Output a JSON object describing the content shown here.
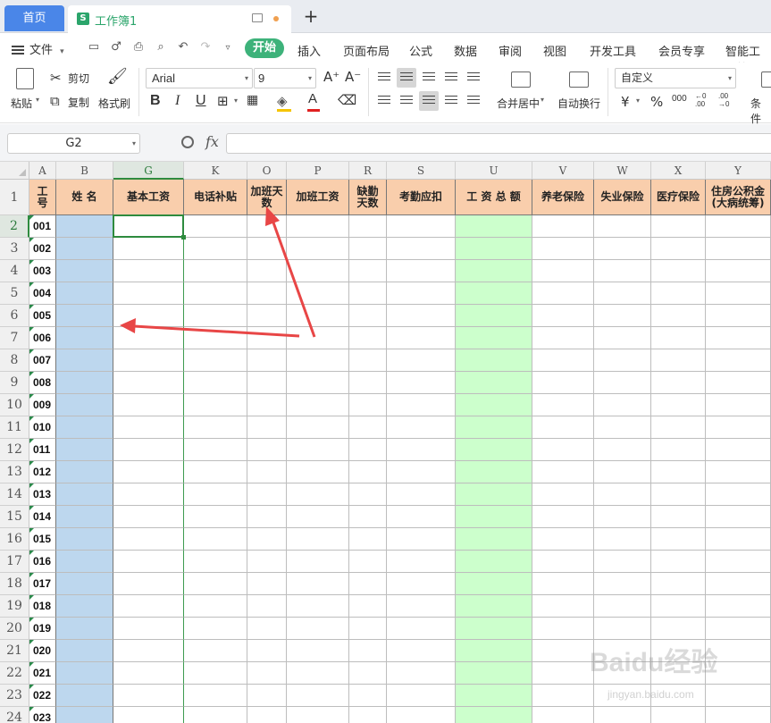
{
  "tabs": {
    "home": "首页",
    "workbook": "工作簿1",
    "new_tab": "+"
  },
  "menu": {
    "file": "文件",
    "start": "开始",
    "items": [
      "插入",
      "页面布局",
      "公式",
      "数据",
      "审阅",
      "视图",
      "开发工具",
      "会员专享",
      "智能工具箱"
    ]
  },
  "ribbon": {
    "paste": "粘贴",
    "cut": "剪切",
    "copy": "复制",
    "format_painter": "格式刷",
    "font_name": "Arial",
    "font_size": "9",
    "grow_font": "A⁺",
    "shrink_font": "A⁻",
    "bold": "B",
    "italic": "I",
    "underline": "U",
    "merge_center": "合并居中",
    "auto_wrap": "自动换行",
    "number_format": "自定义",
    "currency": "¥",
    "percent": "%",
    "thousands": "000",
    "inc_decimal": "←0 .00",
    "dec_decimal": ".00 →0",
    "conditional": "条件"
  },
  "formula_bar": {
    "name_box": "G2",
    "fx": "fx",
    "formula": ""
  },
  "columns": [
    {
      "letter": "A",
      "header": "工\n号"
    },
    {
      "letter": "B",
      "header": "姓    名"
    },
    {
      "letter": "G",
      "header": "基本工资"
    },
    {
      "letter": "K",
      "header": "电话补贴"
    },
    {
      "letter": "O",
      "header": "加班天\n数"
    },
    {
      "letter": "P",
      "header": "加班工资"
    },
    {
      "letter": "R",
      "header": "缺勤\n天数"
    },
    {
      "letter": "S",
      "header": "考勤应扣"
    },
    {
      "letter": "U",
      "header": "工 资 总 额"
    },
    {
      "letter": "V",
      "header": "养老保险"
    },
    {
      "letter": "W",
      "header": "失业保险"
    },
    {
      "letter": "X",
      "header": "医疗保险"
    },
    {
      "letter": "Y",
      "header": "住房公积金\n(大病统筹)"
    }
  ],
  "rows": [
    "1",
    "2",
    "3",
    "4",
    "5",
    "6",
    "7",
    "8",
    "9",
    "10",
    "11",
    "12",
    "13",
    "14",
    "15",
    "16",
    "17",
    "18",
    "19",
    "20",
    "21",
    "22",
    "23",
    "24"
  ],
  "ids": [
    "001",
    "002",
    "003",
    "004",
    "005",
    "006",
    "007",
    "008",
    "009",
    "010",
    "011",
    "012",
    "013",
    "014",
    "015",
    "016",
    "017",
    "018",
    "019",
    "020",
    "021",
    "022",
    "023"
  ],
  "selected_cell": "G2",
  "colors": {
    "header_fill": "#f9ceac",
    "name_column_fill": "#bdd7ee",
    "total_column_fill": "#ccffcc",
    "accent": "#2e8b3e",
    "arrow": "#e84646"
  },
  "watermark": {
    "main": "Baidu经验",
    "sub": "jingyan.baidu.com"
  }
}
